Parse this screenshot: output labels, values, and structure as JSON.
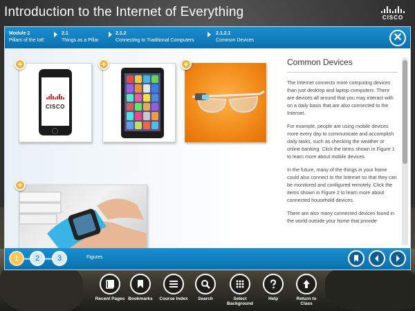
{
  "app": {
    "title": "Introduction to the Internet of Everything",
    "brand": "CISCO"
  },
  "breadcrumbs": [
    {
      "top": "Module 2",
      "bottom": "Pillars of the IoE"
    },
    {
      "top": "2.1",
      "bottom": "Things as a Pillar"
    },
    {
      "top": "2.1.2",
      "bottom": "Connecting to Traditional Computers"
    },
    {
      "top": "2.1.2.1",
      "bottom": "Common Devices"
    }
  ],
  "figures": {
    "phone_logo": "CISCO",
    "plus_symbol": "+"
  },
  "article": {
    "heading": "Common Devices",
    "paragraphs": [
      "The Internet connects more computing devices than just desktop and laptop computers. There are devices all around that you may interact with on a daily basis that are also connected to the Internet.",
      "For example, people are using mobile devices more every day to communicate and accomplish daily tasks, such as checking the weather or online banking. Click the items shown in Figure 1 to learn more about mobile devices.",
      "In the future, many of the things in your home could also connect to the Internet so that they can be monitored and configured remotely. Click the items shown in Figure 2 to learn more about connected household devices.",
      "There are also many connected devices found in the world outside your home that provide"
    ]
  },
  "figure_nav": {
    "numbers": [
      "1",
      "2",
      "3"
    ],
    "active": "1",
    "label": "Figures"
  },
  "close_symbol": "✕",
  "toolbar": [
    {
      "label": "Recent Pages",
      "icon": "recent-pages-icon"
    },
    {
      "label": "Bookmarks",
      "icon": "bookmark-icon"
    },
    {
      "label": "Course Index",
      "icon": "list-icon"
    },
    {
      "label": "Search",
      "icon": "search-icon"
    },
    {
      "label": "Select Background",
      "icon": "grid-dots-icon"
    },
    {
      "label": "Help",
      "icon": "help-icon"
    },
    {
      "label": "Return to Class",
      "icon": "return-up-arrow-icon"
    }
  ],
  "colors": {
    "accent_blue": "#0b6fae",
    "badge_orange": "#f0b33c",
    "glasses_bg": "#f18a17"
  }
}
